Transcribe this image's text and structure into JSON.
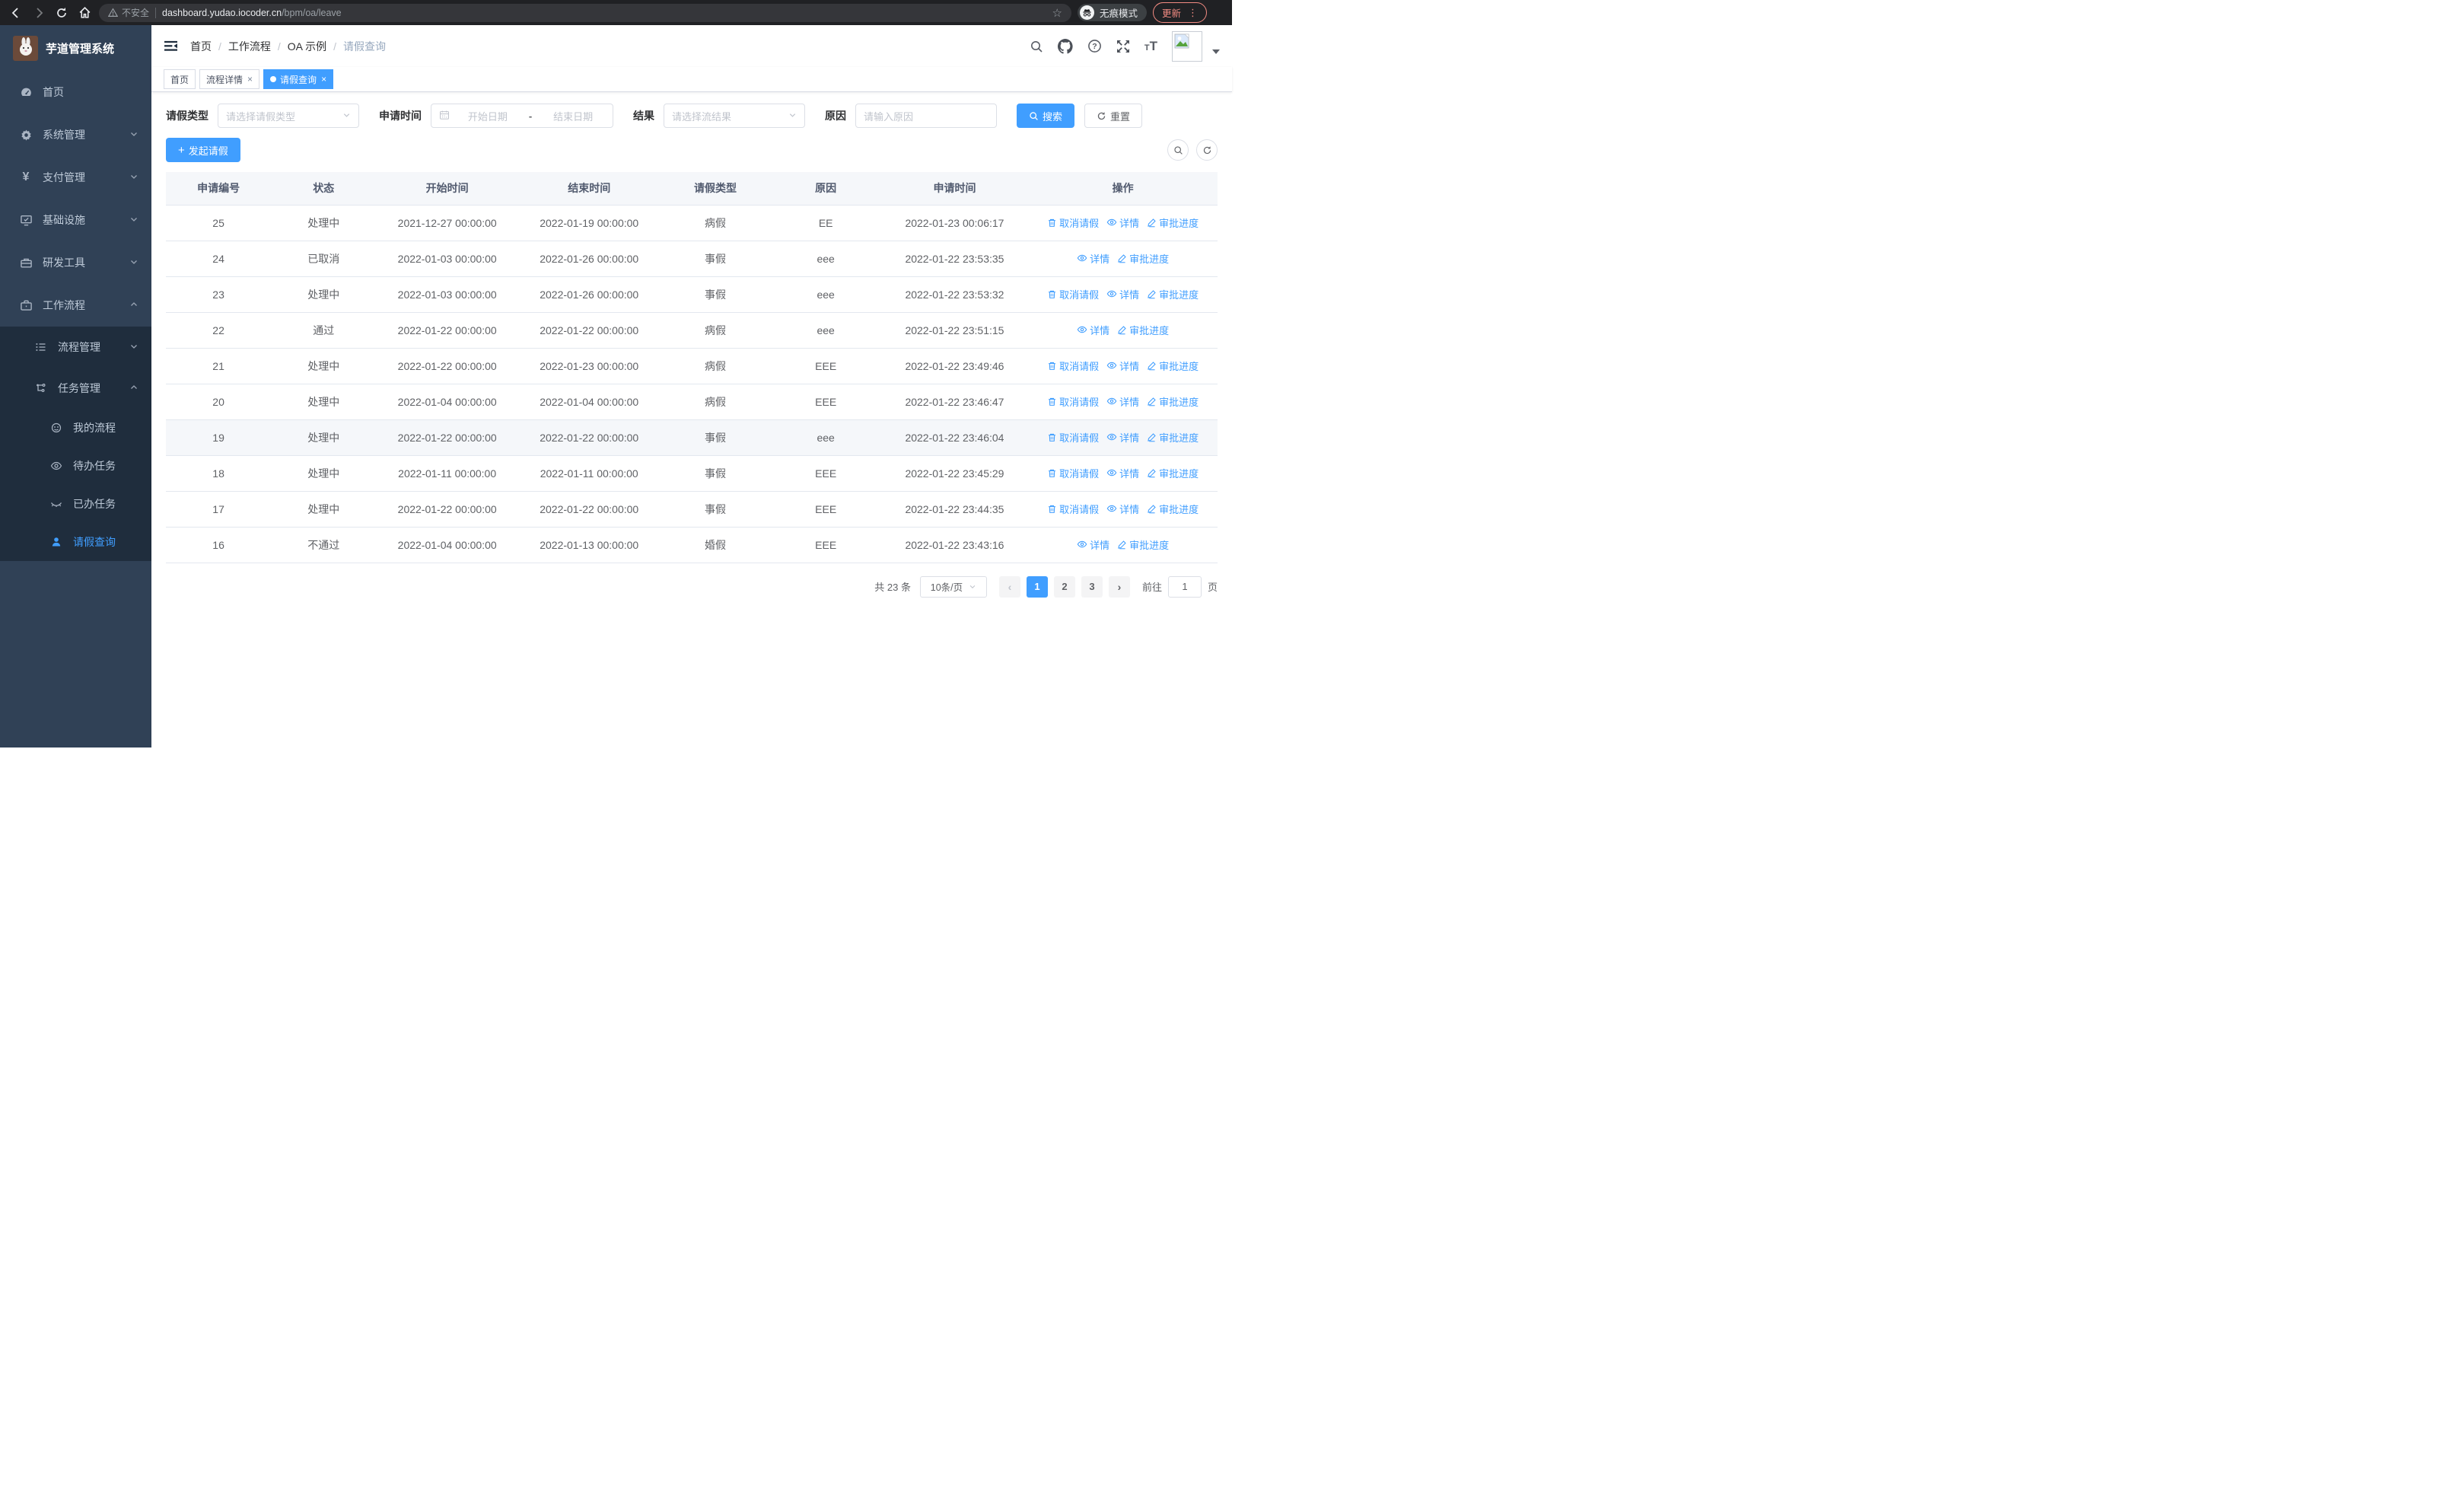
{
  "colors": {
    "accent": "#409eff",
    "sidebar_bg": "#304156",
    "submenu_bg": "#1f2d3d",
    "update_accent": "#f28b82",
    "table_header_bg": "#f5f7fa"
  },
  "browser": {
    "security_label": "不安全",
    "url_host": "dashboard.yudao.iocoder.cn",
    "url_path": "/bpm/oa/leave",
    "star_glyph": "☆",
    "incognito_label": "无痕模式",
    "update_label": "更新",
    "menu_dots_glyph": "⋮"
  },
  "sidebar": {
    "title": "芋道管理系统",
    "menu": [
      {
        "label": "首页"
      },
      {
        "label": "系统管理"
      },
      {
        "label": "支付管理",
        "icon_glyph": "¥"
      },
      {
        "label": "基础设施"
      },
      {
        "label": "研发工具"
      },
      {
        "label": "工作流程"
      }
    ],
    "submenu": [
      {
        "label": "流程管理"
      },
      {
        "label": "任务管理"
      }
    ],
    "task_items": [
      {
        "label": "我的流程"
      },
      {
        "label": "待办任务"
      },
      {
        "label": "已办任务"
      },
      {
        "label": "请假查询"
      }
    ]
  },
  "header": {
    "breadcrumb": [
      "首页",
      "工作流程",
      "OA 示例",
      "请假查询"
    ],
    "separator": "/",
    "help_glyph": "?",
    "font_icon_small": "T",
    "font_icon_large": "T"
  },
  "tabs": [
    {
      "label": "首页"
    },
    {
      "label": "流程详情",
      "close_glyph": "×"
    },
    {
      "label": "请假查询",
      "close_glyph": "×"
    }
  ],
  "filters": {
    "leave_type_label": "请假类型",
    "leave_type_placeholder": "请选择请假类型",
    "apply_time_label": "申请时间",
    "date_start_placeholder": "开始日期",
    "date_separator": "-",
    "date_end_placeholder": "结束日期",
    "result_label": "结果",
    "result_placeholder": "请选择流结果",
    "reason_label": "原因",
    "reason_placeholder": "请输入原因",
    "search_label": "搜索",
    "reset_label": "重置"
  },
  "toolbar": {
    "create_label": "发起请假",
    "plus_glyph": "+"
  },
  "table": {
    "columns": [
      "申请编号",
      "状态",
      "开始时间",
      "结束时间",
      "请假类型",
      "原因",
      "申请时间",
      "操作"
    ],
    "action_cancel": "取消请假",
    "action_detail": "详情",
    "action_progress": "审批进度",
    "rows": [
      {
        "id": "25",
        "status": "处理中",
        "start": "2021-12-27 00:00:00",
        "end": "2022-01-19 00:00:00",
        "type": "病假",
        "reason": "EE",
        "applied": "2022-01-23 00:06:17"
      },
      {
        "id": "24",
        "status": "已取消",
        "start": "2022-01-03 00:00:00",
        "end": "2022-01-26 00:00:00",
        "type": "事假",
        "reason": "eee",
        "applied": "2022-01-22 23:53:35"
      },
      {
        "id": "23",
        "status": "处理中",
        "start": "2022-01-03 00:00:00",
        "end": "2022-01-26 00:00:00",
        "type": "事假",
        "reason": "eee",
        "applied": "2022-01-22 23:53:32"
      },
      {
        "id": "22",
        "status": "通过",
        "start": "2022-01-22 00:00:00",
        "end": "2022-01-22 00:00:00",
        "type": "病假",
        "reason": "eee",
        "applied": "2022-01-22 23:51:15"
      },
      {
        "id": "21",
        "status": "处理中",
        "start": "2022-01-22 00:00:00",
        "end": "2022-01-23 00:00:00",
        "type": "病假",
        "reason": "EEE",
        "applied": "2022-01-22 23:49:46"
      },
      {
        "id": "20",
        "status": "处理中",
        "start": "2022-01-04 00:00:00",
        "end": "2022-01-04 00:00:00",
        "type": "病假",
        "reason": "EEE",
        "applied": "2022-01-22 23:46:47"
      },
      {
        "id": "19",
        "status": "处理中",
        "start": "2022-01-22 00:00:00",
        "end": "2022-01-22 00:00:00",
        "type": "事假",
        "reason": "eee",
        "applied": "2022-01-22 23:46:04"
      },
      {
        "id": "18",
        "status": "处理中",
        "start": "2022-01-11 00:00:00",
        "end": "2022-01-11 00:00:00",
        "type": "事假",
        "reason": "EEE",
        "applied": "2022-01-22 23:45:29"
      },
      {
        "id": "17",
        "status": "处理中",
        "start": "2022-01-22 00:00:00",
        "end": "2022-01-22 00:00:00",
        "type": "事假",
        "reason": "EEE",
        "applied": "2022-01-22 23:44:35"
      },
      {
        "id": "16",
        "status": "不通过",
        "start": "2022-01-04 00:00:00",
        "end": "2022-01-13 00:00:00",
        "type": "婚假",
        "reason": "EEE",
        "applied": "2022-01-22 23:43:16"
      }
    ]
  },
  "pagination": {
    "total_label": "共 23 条",
    "page_size_label": "10条/页",
    "prev_glyph": "‹",
    "next_glyph": "›",
    "pages": [
      "1",
      "2",
      "3"
    ],
    "active_page": "1",
    "goto_label": "前往",
    "goto_value": "1",
    "unit_label": "页"
  }
}
